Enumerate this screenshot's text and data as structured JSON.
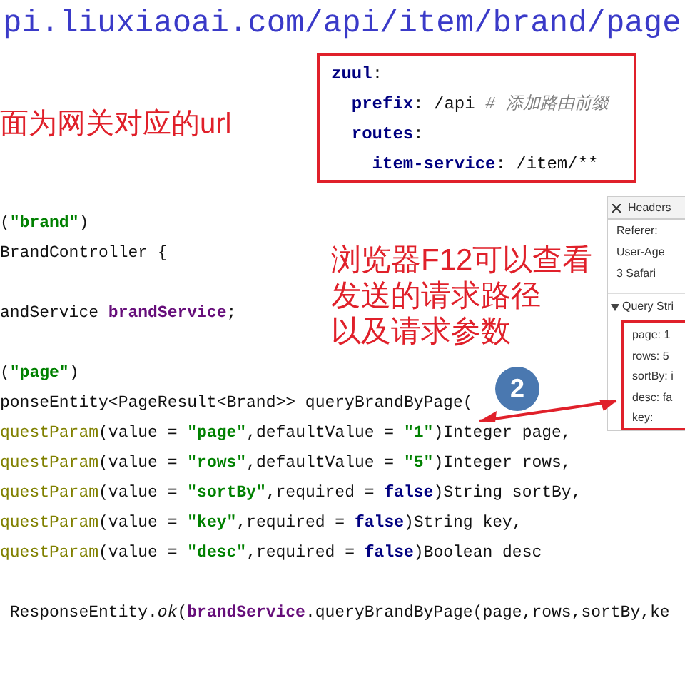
{
  "url": "pi.liuxiaoai.com/api/item/brand/page",
  "gateway_note": "面为网关对应的url",
  "zuul_config": [
    {
      "tokens": [
        {
          "text": "zuul",
          "kind": "key"
        },
        {
          "text": ":",
          "kind": "plain"
        }
      ]
    },
    {
      "tokens": [
        {
          "text": "  prefix",
          "kind": "key"
        },
        {
          "text": ": /api ",
          "kind": "plain"
        },
        {
          "text": "# 添加路由前缀",
          "kind": "comment"
        }
      ]
    },
    {
      "tokens": [
        {
          "text": "  routes",
          "kind": "key"
        },
        {
          "text": ":",
          "kind": "plain"
        }
      ]
    },
    {
      "tokens": [
        {
          "text": "    item-service",
          "kind": "key"
        },
        {
          "text": ": /item/**",
          "kind": "plain"
        }
      ]
    }
  ],
  "browser_note": [
    "浏览器F12可以查看",
    "发送的请求路径",
    "以及请求参数"
  ],
  "devtools": {
    "tab": "Headers",
    "header_lines": [
      "Referer:",
      "User-Age",
      "3 Safari"
    ],
    "section": "Query Stri",
    "params": [
      "page: 1",
      "rows: 5",
      "sortBy: i",
      "desc: fa",
      "key:"
    ]
  },
  "step_badge": "2",
  "code_lines": [
    {
      "kind": "code",
      "tokens": [
        {
          "text": "(",
          "kind": "plain"
        },
        {
          "text": "\"brand\"",
          "kind": "string"
        },
        {
          "text": ")",
          "kind": "plain"
        }
      ]
    },
    {
      "kind": "code",
      "tokens": [
        {
          "text": "BrandController {",
          "kind": "plain"
        }
      ]
    },
    {
      "kind": "blank"
    },
    {
      "kind": "code",
      "tokens": [
        {
          "text": "andService ",
          "kind": "plain"
        },
        {
          "text": "brandService",
          "kind": "field"
        },
        {
          "text": ";",
          "kind": "plain"
        }
      ]
    },
    {
      "kind": "blank"
    },
    {
      "kind": "code",
      "tokens": [
        {
          "text": "(",
          "kind": "plain"
        },
        {
          "text": "\"page\"",
          "kind": "string"
        },
        {
          "text": ")",
          "kind": "plain"
        }
      ]
    },
    {
      "kind": "code",
      "tokens": [
        {
          "text": "ponseEntity<PageResult<Brand>> queryBrandByPage(",
          "kind": "plain"
        }
      ]
    },
    {
      "kind": "code",
      "tokens": [
        {
          "text": "questParam",
          "kind": "annotation"
        },
        {
          "text": "(value = ",
          "kind": "plain"
        },
        {
          "text": "\"page\"",
          "kind": "string"
        },
        {
          "text": ",defaultValue = ",
          "kind": "plain"
        },
        {
          "text": "\"1\"",
          "kind": "string"
        },
        {
          "text": ")Integer page,",
          "kind": "plain"
        }
      ]
    },
    {
      "kind": "code",
      "tokens": [
        {
          "text": "questParam",
          "kind": "annotation"
        },
        {
          "text": "(value = ",
          "kind": "plain"
        },
        {
          "text": "\"rows\"",
          "kind": "string"
        },
        {
          "text": ",defaultValue = ",
          "kind": "plain"
        },
        {
          "text": "\"5\"",
          "kind": "string"
        },
        {
          "text": ")Integer rows,",
          "kind": "plain"
        }
      ]
    },
    {
      "kind": "code",
      "tokens": [
        {
          "text": "questParam",
          "kind": "annotation"
        },
        {
          "text": "(value = ",
          "kind": "plain"
        },
        {
          "text": "\"sortBy\"",
          "kind": "string"
        },
        {
          "text": ",required = ",
          "kind": "plain"
        },
        {
          "text": "false",
          "kind": "keyword"
        },
        {
          "text": ")String sortBy,",
          "kind": "plain"
        }
      ]
    },
    {
      "kind": "code",
      "tokens": [
        {
          "text": "questParam",
          "kind": "annotation"
        },
        {
          "text": "(value = ",
          "kind": "plain"
        },
        {
          "text": "\"key\"",
          "kind": "string"
        },
        {
          "text": ",required = ",
          "kind": "plain"
        },
        {
          "text": "false",
          "kind": "keyword"
        },
        {
          "text": ")String key,",
          "kind": "plain"
        }
      ]
    },
    {
      "kind": "code",
      "tokens": [
        {
          "text": "questParam",
          "kind": "annotation"
        },
        {
          "text": "(value = ",
          "kind": "plain"
        },
        {
          "text": "\"desc\"",
          "kind": "string"
        },
        {
          "text": ",required = ",
          "kind": "plain"
        },
        {
          "text": "false",
          "kind": "keyword"
        },
        {
          "text": ")Boolean desc",
          "kind": "plain"
        }
      ]
    },
    {
      "kind": "blank"
    },
    {
      "kind": "code",
      "tokens": [
        {
          "text": " ResponseEntity.",
          "kind": "plain"
        },
        {
          "text": "ok",
          "kind": "italic"
        },
        {
          "text": "(",
          "kind": "plain"
        },
        {
          "text": "brandService",
          "kind": "field"
        },
        {
          "text": ".queryBrandByPage(page,rows,sortBy,ke",
          "kind": "plain"
        }
      ]
    }
  ]
}
